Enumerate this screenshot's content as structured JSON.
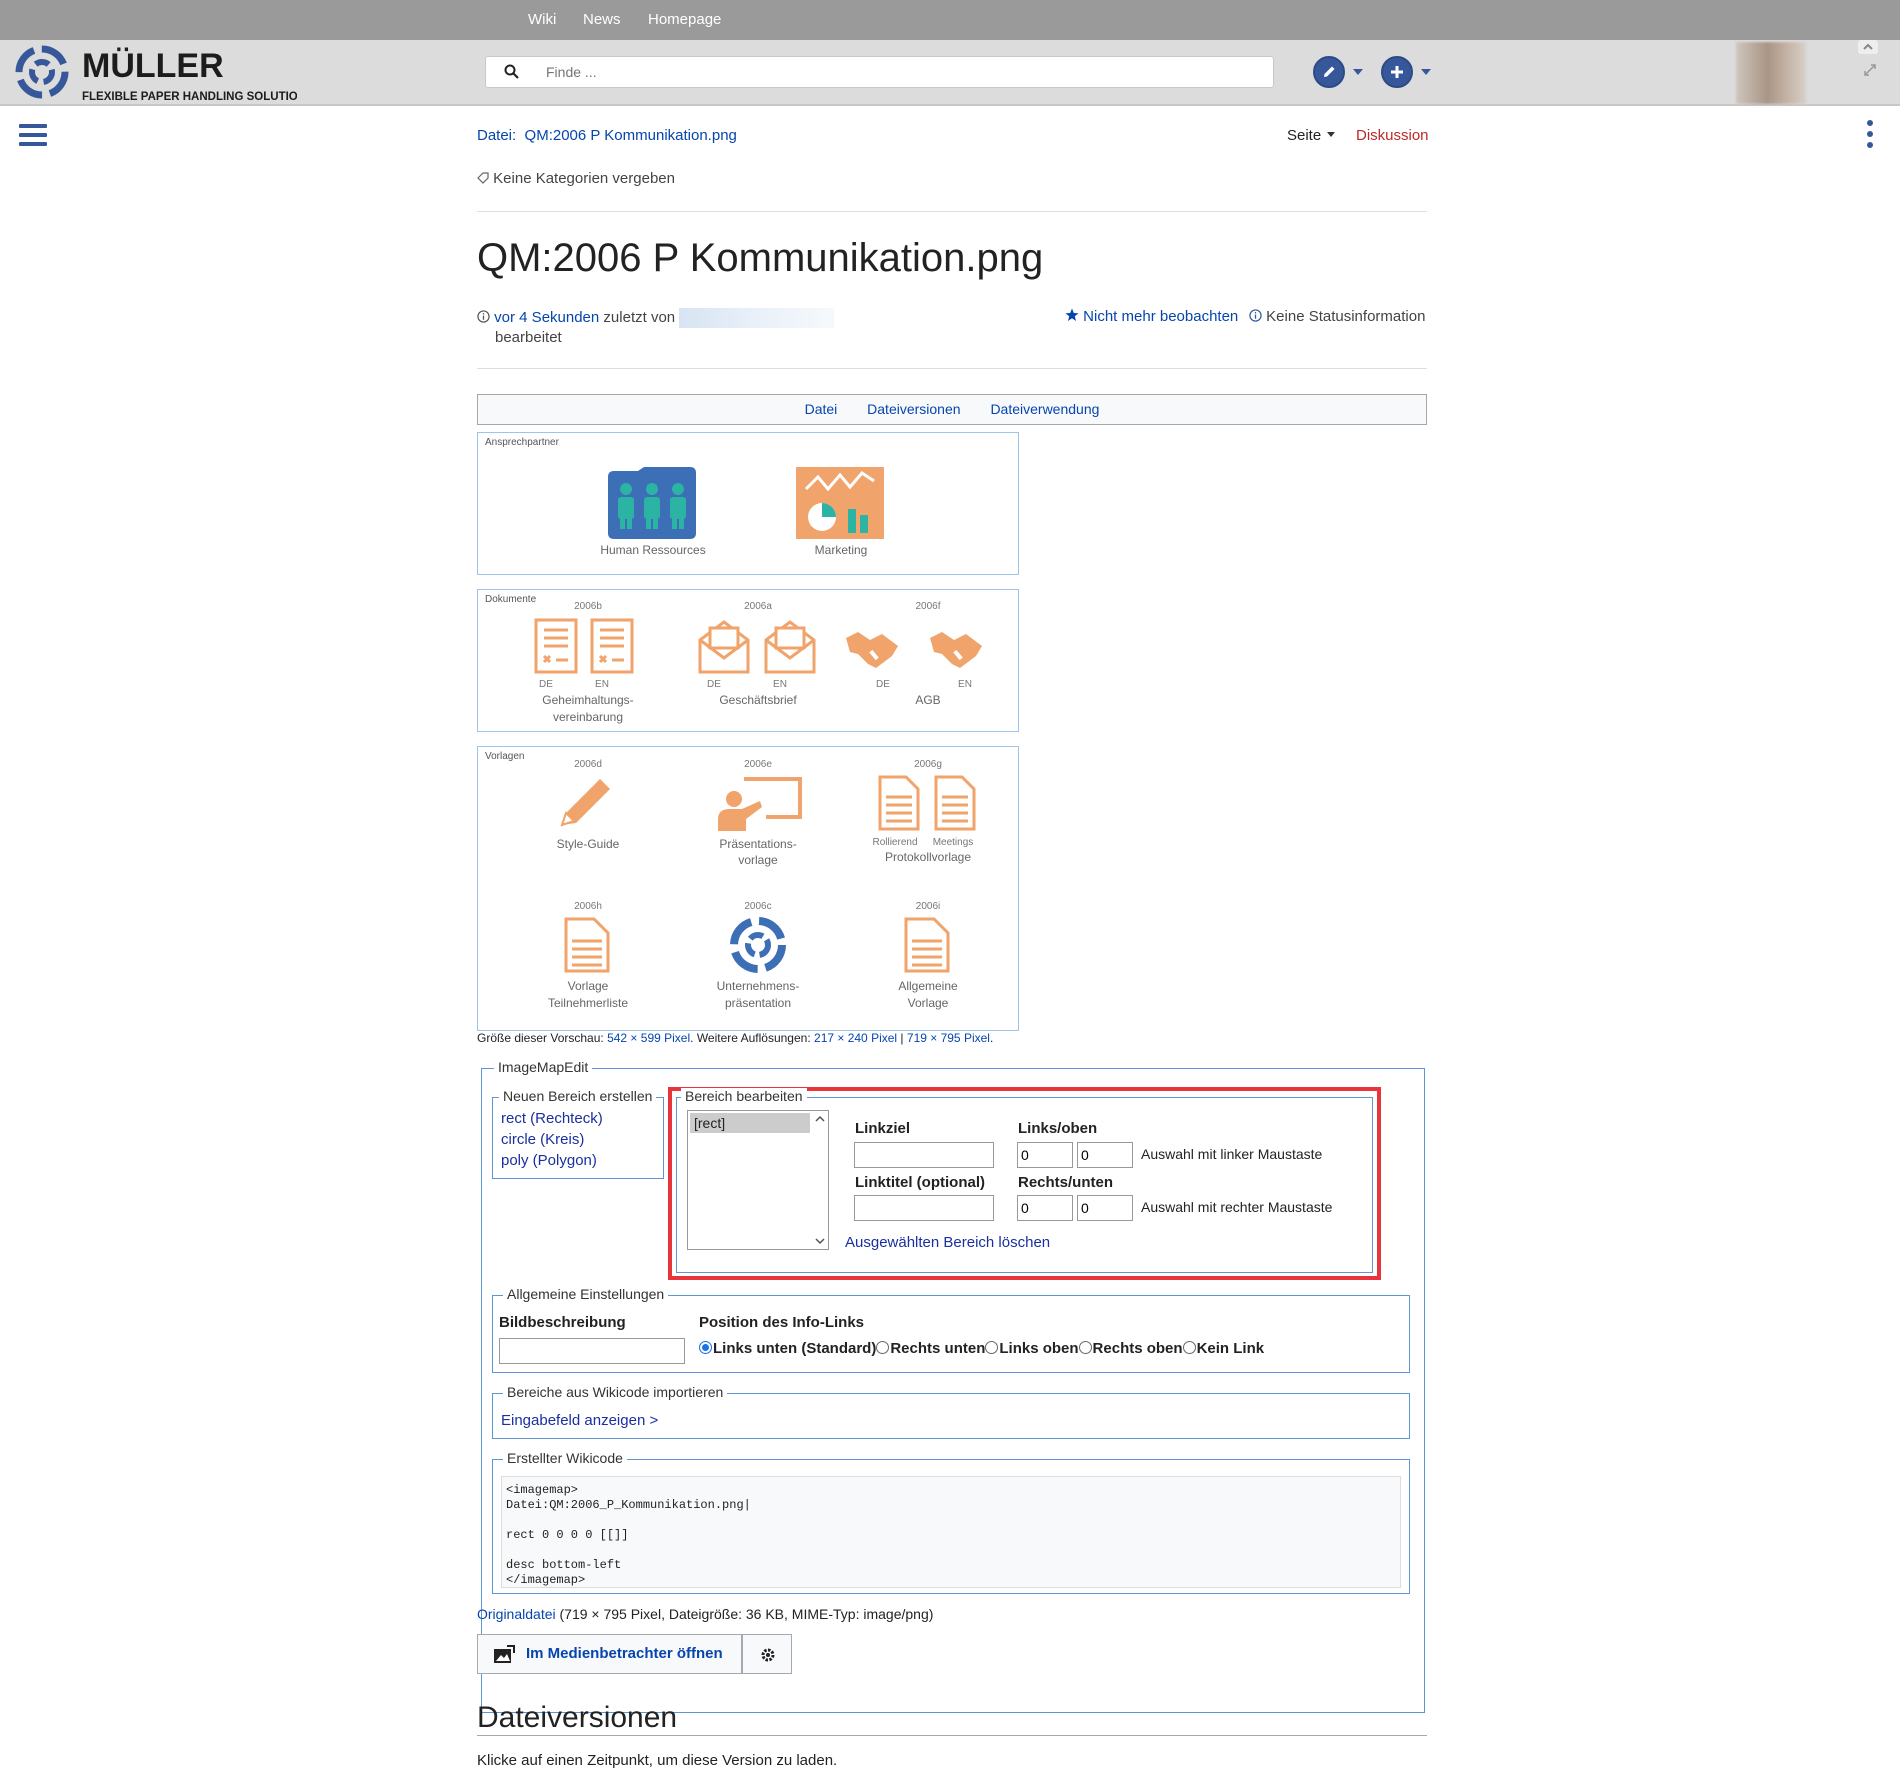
{
  "topnav": [
    "Wiki",
    "News",
    "Homepage"
  ],
  "brand": {
    "name": "MÜLLER",
    "tagline": "FLEXIBLE PAPER HANDLING SOLUTIONS",
    "color": "#36589a"
  },
  "search": {
    "placeholder": "Finde ..."
  },
  "breadcrumb": {
    "prefix": "Datei:",
    "title": "QM:2006 P Kommunikation.png"
  },
  "page_actions": {
    "seite": "Seite",
    "diskussion": "Diskussion"
  },
  "categories": "Keine Kategorien vergeben",
  "title": "QM:2006 P Kommunikation.png",
  "meta": {
    "time_link": "vor 4 Sekunden",
    "edited_by": "zuletzt von",
    "suffix": "bearbeitet",
    "watch": "Nicht mehr beobachten",
    "status": "Keine Statusinformation"
  },
  "file_tabs": [
    "Datei",
    "Dateiversionen",
    "Dateiverwendung"
  ],
  "image": {
    "ansprech": {
      "title": "Ansprechpartner",
      "hr": "Human Ressources",
      "marketing": "Marketing"
    },
    "dokumente": {
      "title": "Dokumente",
      "codes": [
        "2006b",
        "2006a",
        "2006f"
      ],
      "de": "DE",
      "en": "EN",
      "names": [
        "Geheimhaltungs-",
        "vereinbarung",
        "Geschäftsbrief",
        "AGB"
      ]
    },
    "vorlagen": {
      "title": "Vorlagen",
      "codes": [
        "2006d",
        "2006e",
        "2006g",
        "2006h",
        "2006c",
        "2006i"
      ],
      "style": "Style-Guide",
      "praes1": "Präsentations-",
      "praes2": "vorlage",
      "rollierend": "Rollierend",
      "meetings": "Meetings",
      "protokoll": "Protokollvorlage",
      "vorlage": "Vorlage",
      "teilnehmer": "Teilnehmerliste",
      "unternehmens": "Unternehmens-",
      "praesentation": "präsentation",
      "allgemeine": "Allgemeine",
      "vorlage2": "Vorlage"
    },
    "orange": "#f0a36a",
    "blue": "#3d6fb6",
    "teal": "#2bb3a3"
  },
  "preview_sizes": {
    "label": "Größe dieser Vorschau:",
    "preview": "542 × 599 Pixel",
    "more": "Weitere Auflösungen:",
    "r1": "217 × 240 Pixel",
    "sep": "|",
    "r2": "719 × 795 Pixel",
    "end": "."
  },
  "imagemapedit": {
    "title": "ImageMapEdit",
    "new_area": {
      "title": "Neuen Bereich erstellen",
      "items": [
        "rect (Rechteck)",
        "circle (Kreis)",
        "poly (Polygon)"
      ]
    },
    "edit_area": {
      "title": "Bereich bearbeiten",
      "list_item": "[rect]",
      "linkziel": "Linkziel",
      "linktitel": "Linktitel (optional)",
      "links_oben": "Links/oben",
      "rechts_unten": "Rechts/unten",
      "x1": "0",
      "y1": "0",
      "x2": "0",
      "y2": "0",
      "left_hint": "Auswahl mit linker Maustaste",
      "right_hint": "Auswahl mit rechter Maustaste",
      "delete": "Ausgewählten Bereich löschen",
      "highlight": "#e8353c"
    },
    "general": {
      "title": "Allgemeine Einstellungen",
      "desc_label": "Bildbeschreibung",
      "pos_label": "Position des Info-Links",
      "options": [
        "Links unten (Standard)",
        "Rechts unten",
        "Links oben",
        "Rechts oben",
        "Kein Link"
      ],
      "selected": 0
    },
    "import": {
      "title": "Bereiche aus Wikicode importieren",
      "link": "Eingabefeld anzeigen >"
    },
    "wikicode": {
      "title": "Erstellter Wikicode",
      "code": "<imagemap>\nDatei:QM:2006_P_Kommunikation.png|\n\nrect 0 0 0 0 [[]]\n\ndesc bottom-left\n</imagemap>"
    }
  },
  "original": {
    "link": "Originaldatei",
    "info": "(719 × 795 Pixel, Dateigröße: 36 KB, MIME-Typ: image/png)"
  },
  "media_viewer": "Im Medienbetrachter öffnen",
  "versions": {
    "heading": "Dateiversionen",
    "hint": "Klicke auf einen Zeitpunkt, um diese Version zu laden."
  }
}
